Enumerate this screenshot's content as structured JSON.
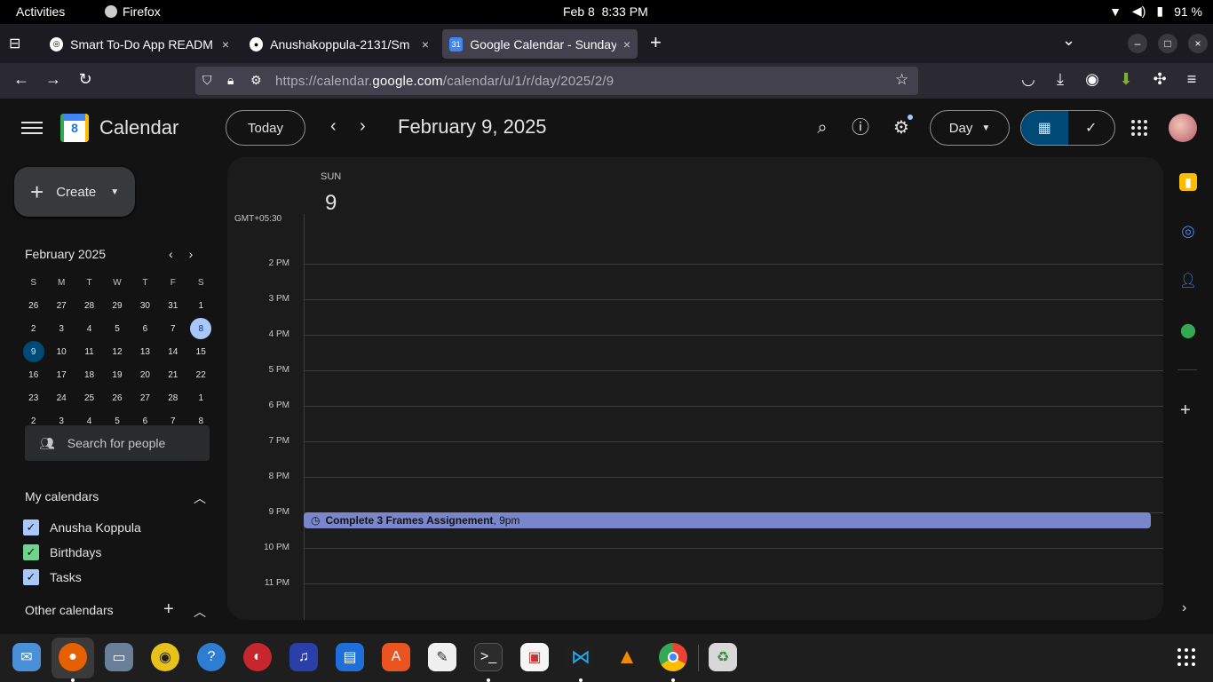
{
  "topbar": {
    "activities": "Activities",
    "app_name": "Firefox",
    "date": "Feb 8",
    "time": "8:33 PM",
    "battery": "91 %"
  },
  "tabs": [
    {
      "label": "Smart To-Do App READM",
      "close": "×",
      "favicon": "openai-icon"
    },
    {
      "label": "Anushakoppula-2131/Sm",
      "close": "×",
      "favicon": "github-icon"
    },
    {
      "label": "Google Calendar - Sunday",
      "close": "×",
      "favicon": "calendar-icon"
    }
  ],
  "tabstrip": {
    "new_tab": "+",
    "list_tabs": "⌄"
  },
  "window_controls": {
    "minimize": "–",
    "maximize": "□",
    "close": "×"
  },
  "navbar": {
    "url_prefix": "https://calendar.",
    "url_host": "google.com",
    "url_path": "/calendar/u/1/r/day/2025/2/9"
  },
  "calendar": {
    "app_title": "Calendar",
    "logo_day": "8",
    "today_button": "Today",
    "prev": "‹",
    "next": "›",
    "date_title": "February 9, 2025",
    "view_label": "Day",
    "create_label": "Create"
  },
  "mini_calendar": {
    "month": "February 2025",
    "weekday_headers": [
      "S",
      "M",
      "T",
      "W",
      "T",
      "F",
      "S"
    ],
    "weeks": [
      [
        "26",
        "27",
        "28",
        "29",
        "30",
        "31",
        "1"
      ],
      [
        "2",
        "3",
        "4",
        "5",
        "6",
        "7",
        "8"
      ],
      [
        "9",
        "10",
        "11",
        "12",
        "13",
        "14",
        "15"
      ],
      [
        "16",
        "17",
        "18",
        "19",
        "20",
        "21",
        "22"
      ],
      [
        "23",
        "24",
        "25",
        "26",
        "27",
        "28",
        "1"
      ],
      [
        "2",
        "3",
        "4",
        "5",
        "6",
        "7",
        "8"
      ]
    ]
  },
  "sidebar": {
    "search_people": "Search for people",
    "my_calendars": "My calendars",
    "calendars": [
      {
        "label": "Anusha Koppula",
        "color": "#a8c7fa"
      },
      {
        "label": "Birthdays",
        "color": "#6dd58c"
      },
      {
        "label": "Tasks",
        "color": "#a8c7fa"
      }
    ],
    "other_calendars": "Other calendars"
  },
  "day_view": {
    "weekday": "SUN",
    "day_number": "9",
    "timezone": "GMT+05:30",
    "hours": [
      "2 PM",
      "3 PM",
      "4 PM",
      "5 PM",
      "6 PM",
      "7 PM",
      "8 PM",
      "9 PM",
      "10 PM",
      "11 PM"
    ],
    "event": {
      "title": "Complete 3 Frames Assignement",
      "time": ", 9pm",
      "color": "#7986cb"
    }
  },
  "colors": {
    "accent": "#a8c7fa",
    "selected_day": "#004a77",
    "background": "#131314"
  }
}
